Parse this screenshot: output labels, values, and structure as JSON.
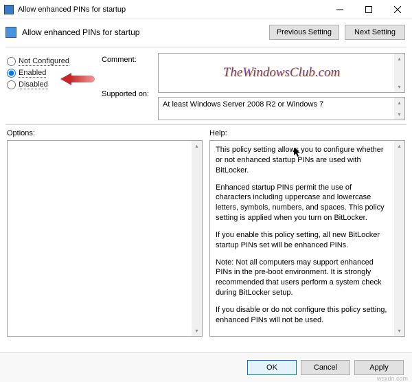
{
  "window": {
    "title": "Allow enhanced PINs for startup",
    "header_title": "Allow enhanced PINs for startup",
    "prev_btn": "Previous Setting",
    "next_btn": "Next Setting"
  },
  "radios": {
    "not_configured": "Not Configured",
    "enabled": "Enabled",
    "disabled": "Disabled",
    "selected": "enabled"
  },
  "labels": {
    "comment": "Comment:",
    "supported": "Supported on:",
    "options": "Options:",
    "help": "Help:"
  },
  "fields": {
    "comment": "",
    "supported": "At least Windows Server 2008 R2 or Windows 7"
  },
  "help": {
    "p1": "This policy setting allows you to configure whether or not enhanced startup PINs are used with BitLocker.",
    "p2": "Enhanced startup PINs permit the use of characters including uppercase and lowercase letters, symbols, numbers, and spaces. This policy setting is applied when you turn on BitLocker.",
    "p3": "If you enable this policy setting, all new BitLocker startup PINs set will be enhanced PINs.",
    "p4": "Note:   Not all computers may support enhanced PINs in the pre-boot environment. It is strongly recommended that users perform a system check during BitLocker setup.",
    "p5": "If you disable or do not configure this policy setting, enhanced PINs will not be used."
  },
  "buttons": {
    "ok": "OK",
    "cancel": "Cancel",
    "apply": "Apply"
  },
  "watermark": "TheWindowsClub.com",
  "source_stamp": "wsxdn.com"
}
